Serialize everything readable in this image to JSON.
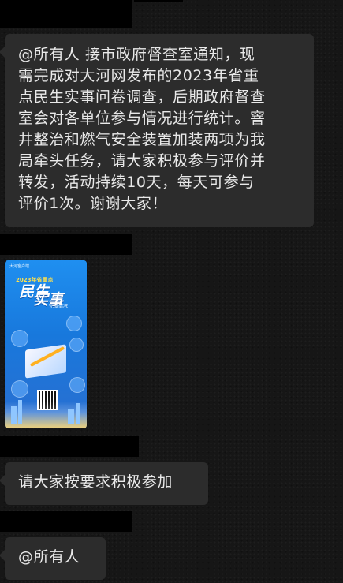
{
  "messages": [
    {
      "text": "@所有人 接市政府督查室通知，现需完成对大河网发布的2023年省重点民生实事问卷调查，后期政府督查室会对各单位参与情况进行统计。窨井整治和燃气安全装置加装两项为我局牵头任务，请大家积极参与评价并转发，活动持续10天，每天可参与评价1次。谢谢大家！",
      "lines": [
        "@所有人 接市政府督查室通知，现",
        "需完成对大河网发布的2023年省重",
        "点民生实事问卷调查，后期政府督查",
        "室会对各单位参与情况进行统计。窨",
        "井整治和燃气安全装置加装两项为我",
        "局牵头任务，请大家积极参与评价并",
        "转发，活动持续10天，每天可参与",
        "评价1次。谢谢大家！"
      ]
    },
    {
      "type": "image",
      "poster": {
        "brand": "大河客户端",
        "year": "2023年省重点",
        "headline_line1": "民生",
        "headline_line2": "实事",
        "subtitle": "完成情况"
      }
    },
    {
      "text": "请大家按要求积极参加"
    },
    {
      "text": "@所有人"
    }
  ],
  "colors": {
    "background": "#161616",
    "bubble": "#2c2c2c",
    "text": "#e9e9e9",
    "redaction": "#000000"
  }
}
